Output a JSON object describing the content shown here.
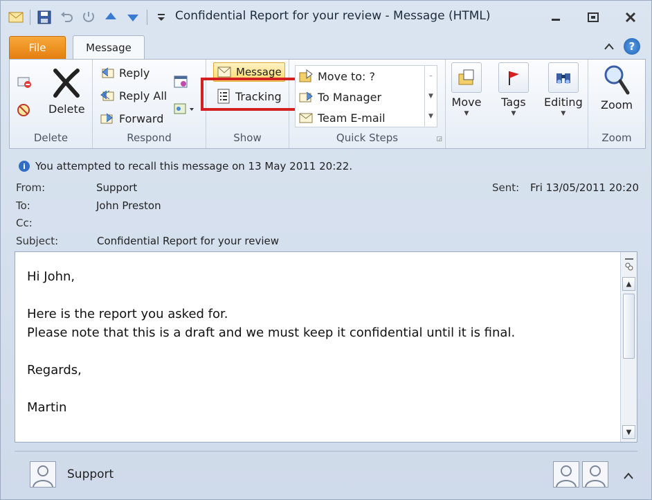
{
  "window": {
    "title": "Confidential Report for your review  -  Message (HTML)"
  },
  "quick_access": {
    "icons": [
      "mail-icon",
      "save-icon",
      "undo-icon",
      "redo-icon",
      "up-icon",
      "down-icon",
      "customize-icon"
    ]
  },
  "tabs": {
    "file": "File",
    "message": "Message"
  },
  "ribbon": {
    "delete": {
      "button": "Delete",
      "group_label": "Delete"
    },
    "respond": {
      "reply": "Reply",
      "reply_all": "Reply All",
      "forward": "Forward",
      "group_label": "Respond"
    },
    "show": {
      "message": "Message",
      "tracking": "Tracking",
      "group_label": "Show"
    },
    "quick_steps": {
      "items": [
        "Move to: ?",
        "To Manager",
        "Team E-mail"
      ],
      "group_label": "Quick Steps"
    },
    "move": {
      "label": "Move"
    },
    "tags": {
      "label": "Tags"
    },
    "editing": {
      "label": "Editing"
    },
    "zoom": {
      "button": "Zoom",
      "group_label": "Zoom"
    }
  },
  "info_bar": {
    "text": "You attempted to recall this message on 13 May 2011 20:22."
  },
  "header": {
    "from_label": "From:",
    "from_value": "Support",
    "to_label": "To:",
    "to_value": "John Preston",
    "cc_label": "Cc:",
    "subject_label": "Subject:",
    "subject_value": "Confidential Report for your review",
    "sent_label": "Sent:",
    "sent_value": "Fri 13/05/2011 20:20"
  },
  "body": {
    "lines": [
      "Hi John,",
      "",
      "Here is the report you asked for.",
      "Please note that this is a draft and we must keep it confidential until it is final.",
      "",
      "Regards,",
      "",
      "Martin"
    ]
  },
  "people_pane": {
    "name": "Support"
  },
  "colors": {
    "file_tab": "#e88a1a",
    "highlight": "#d32020",
    "accent": "#2f6ec4"
  }
}
